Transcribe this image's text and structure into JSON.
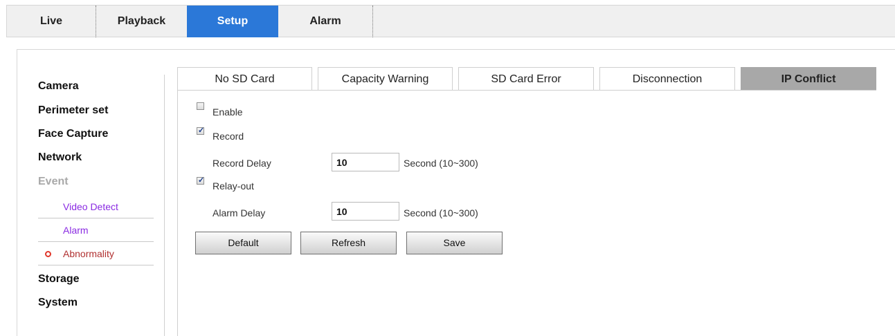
{
  "top_nav": {
    "tabs": [
      {
        "label": "Live"
      },
      {
        "label": "Playback"
      },
      {
        "label": "Setup"
      },
      {
        "label": "Alarm"
      }
    ],
    "active": "Setup"
  },
  "side_menu": {
    "camera": "Camera",
    "perimeter": "Perimeter set",
    "face_capture": "Face Capture",
    "network": "Network",
    "event": "Event",
    "event_items": [
      {
        "label": "Video Detect"
      },
      {
        "label": "Alarm"
      },
      {
        "label": "Abnormality"
      }
    ],
    "storage": "Storage",
    "system": "System"
  },
  "sub_tabs": [
    {
      "label": "No SD Card"
    },
    {
      "label": "Capacity Warning"
    },
    {
      "label": "SD Card Error"
    },
    {
      "label": "Disconnection"
    },
    {
      "label": "IP Conflict"
    }
  ],
  "form": {
    "enable": {
      "label": "Enable",
      "checked": false
    },
    "record": {
      "label": "Record",
      "checked": true
    },
    "record_delay": {
      "label": "Record Delay",
      "value": "10",
      "unit": "Second (10~300)"
    },
    "relay_out": {
      "label": "Relay-out",
      "checked": true
    },
    "alarm_delay": {
      "label": "Alarm Delay",
      "value": "10",
      "unit": "Second (10~300)"
    }
  },
  "buttons": {
    "default": "Default",
    "refresh": "Refresh",
    "save": "Save"
  },
  "colors": {
    "active_tab": "#2b78d8",
    "active_subtab": "#a8a8a8",
    "submenu_link": "#8a2be2",
    "bullet": "#e0372b"
  }
}
